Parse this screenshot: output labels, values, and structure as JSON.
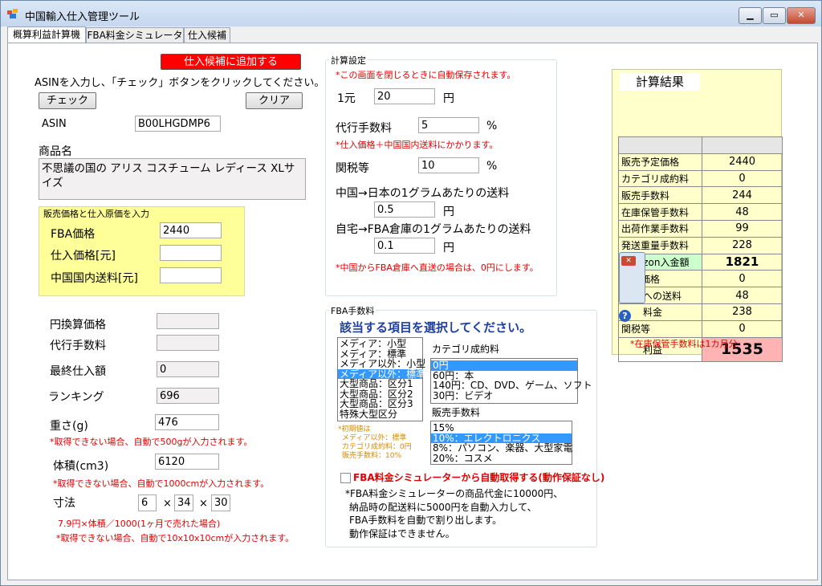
{
  "window": {
    "title": "中国輸入仕入管理ツール"
  },
  "tabs": [
    "概算利益計算機",
    "FBA料金シミュレーター",
    "仕入候補"
  ],
  "left": {
    "add_candidate_btn": "仕入候補に追加する",
    "instruction": "ASINを入力し、「チェック」ボタンをクリックしてください。",
    "check_btn": "チェック",
    "clear_btn": "クリア",
    "asin_label": "ASIN",
    "asin_value": "B00LHGDMP6",
    "product_label": "商品名",
    "product_value": "不思議の国の アリス コスチューム レディース XLサイズ",
    "price_group_title": "販売価格と仕入原価を入力",
    "fba_price_label": "FBA価格",
    "fba_price_value": "2440",
    "purchase_price_label": "仕入価格[元]",
    "purchase_price_value": "",
    "domestic_shipping_label": "中国国内送料[元]",
    "domestic_shipping_value": "",
    "yen_price_label": "円換算価格",
    "yen_price_value": "",
    "agency_fee_label": "代行手数料",
    "agency_fee_value": "",
    "final_cost_label": "最終仕入額",
    "final_cost_value": "0",
    "ranking_label": "ランキング",
    "ranking_value": "696",
    "weight_label": "重さ(g)",
    "weight_value": "476",
    "weight_note": "*取得できない場合、自動で500gが入力されます。",
    "volume_label": "体積(cm3)",
    "volume_value": "6120",
    "volume_note": "*取得できない場合、自動で1000cmが入力されます。",
    "dimension_label": "寸法",
    "dim1": "6",
    "dim2": "34",
    "dim3": "30",
    "times1": "×",
    "times2": "×",
    "dim_note1": "7.9円×体積／1000(1ヶ月で売れた場合)",
    "dim_note2": "*取得できない場合、自動で10x10x10cmが入力されます。"
  },
  "settings": {
    "group_title": "計算設定",
    "autosave_note": "*この画面を閉じるときに自動保存されます。",
    "rate_label": "1元",
    "rate_value": "20",
    "rate_unit": "円",
    "agency_label": "代行手数料",
    "agency_value": "5",
    "agency_unit": "%",
    "agency_note": "*仕入価格＋中国国内送料にかかります。",
    "tariff_label": "関税等",
    "tariff_value": "10",
    "tariff_unit": "%",
    "cn_jp_label": "中国→日本の1グラムあたりの送料",
    "cn_jp_value": "0.5",
    "cn_jp_unit": "円",
    "home_fba_label": "自宅→FBA倉庫の1グラムあたりの送料",
    "home_fba_value": "0.1",
    "home_fba_unit": "円",
    "direct_note": "*中国からFBA倉庫へ直送の場合は、0円にします。"
  },
  "fba": {
    "group_title": "FBA手数料",
    "heading": "該当する項目を選択してください。",
    "size_items": [
      "メディア：小型",
      "メディア：標準",
      "メディア以外：小型",
      "メディア以外：標準",
      "大型商品：区分1",
      "大型商品：区分2",
      "大型商品：区分3",
      "特殊大型区分"
    ],
    "size_selected": 3,
    "category_label": "カテゴリ成約料",
    "category_items": [
      "0円",
      "60円：本",
      "140円：CD、DVD、ゲーム、ソフト",
      "30円：ビデオ"
    ],
    "category_selected": 0,
    "sales_fee_label": "販売手数料",
    "sales_items": [
      "15%",
      "10%：エレクトロニクス",
      "8%：パソコン、楽器、大型家電",
      "20%：コスメ"
    ],
    "sales_selected": 1,
    "default_notes": [
      "*初期値は",
      "メディア以外：標準",
      "カテゴリ成約料：0円",
      "販売手数料：10%"
    ],
    "auto_checkbox_label": "FBA料金シミュレーターから自動取得する(動作保証なし)",
    "desc_lines": [
      "*FBA料金シミュレーターの商品代金に10000円、",
      "納品時の配送料に5000円を自動入力して、",
      "FBA手数料を自動で割り出します。",
      "動作保証はできません。"
    ]
  },
  "result": {
    "title": "計算結果",
    "rows": [
      {
        "label": "販売予定価格",
        "value": "2440"
      },
      {
        "label": "カテゴリ成約料",
        "value": "0"
      },
      {
        "label": "販売手数料",
        "value": "244"
      },
      {
        "label": "在庫保管手数料",
        "value": "48"
      },
      {
        "label": "出荷作業手数料",
        "value": "99"
      },
      {
        "label": "発送重量手数料",
        "value": "228"
      },
      {
        "label": "Amazon入金額",
        "value": "1821"
      },
      {
        "label": "仕入価格",
        "value": "0"
      },
      {
        "label": "への送料",
        "value": "48"
      },
      {
        "label": "料金",
        "value": "238"
      },
      {
        "label": "関税等",
        "value": "0"
      },
      {
        "label": "利益",
        "value": "1535"
      }
    ],
    "note": "*在庫保管手数料は1カ月分"
  },
  "colors": {
    "accent_red": "#e00000",
    "highlight_yellow": "#ffff99",
    "amazon_green": "#ccffcc",
    "profit_pink": "#ffb3b3",
    "selection_blue": "#3399ff"
  }
}
